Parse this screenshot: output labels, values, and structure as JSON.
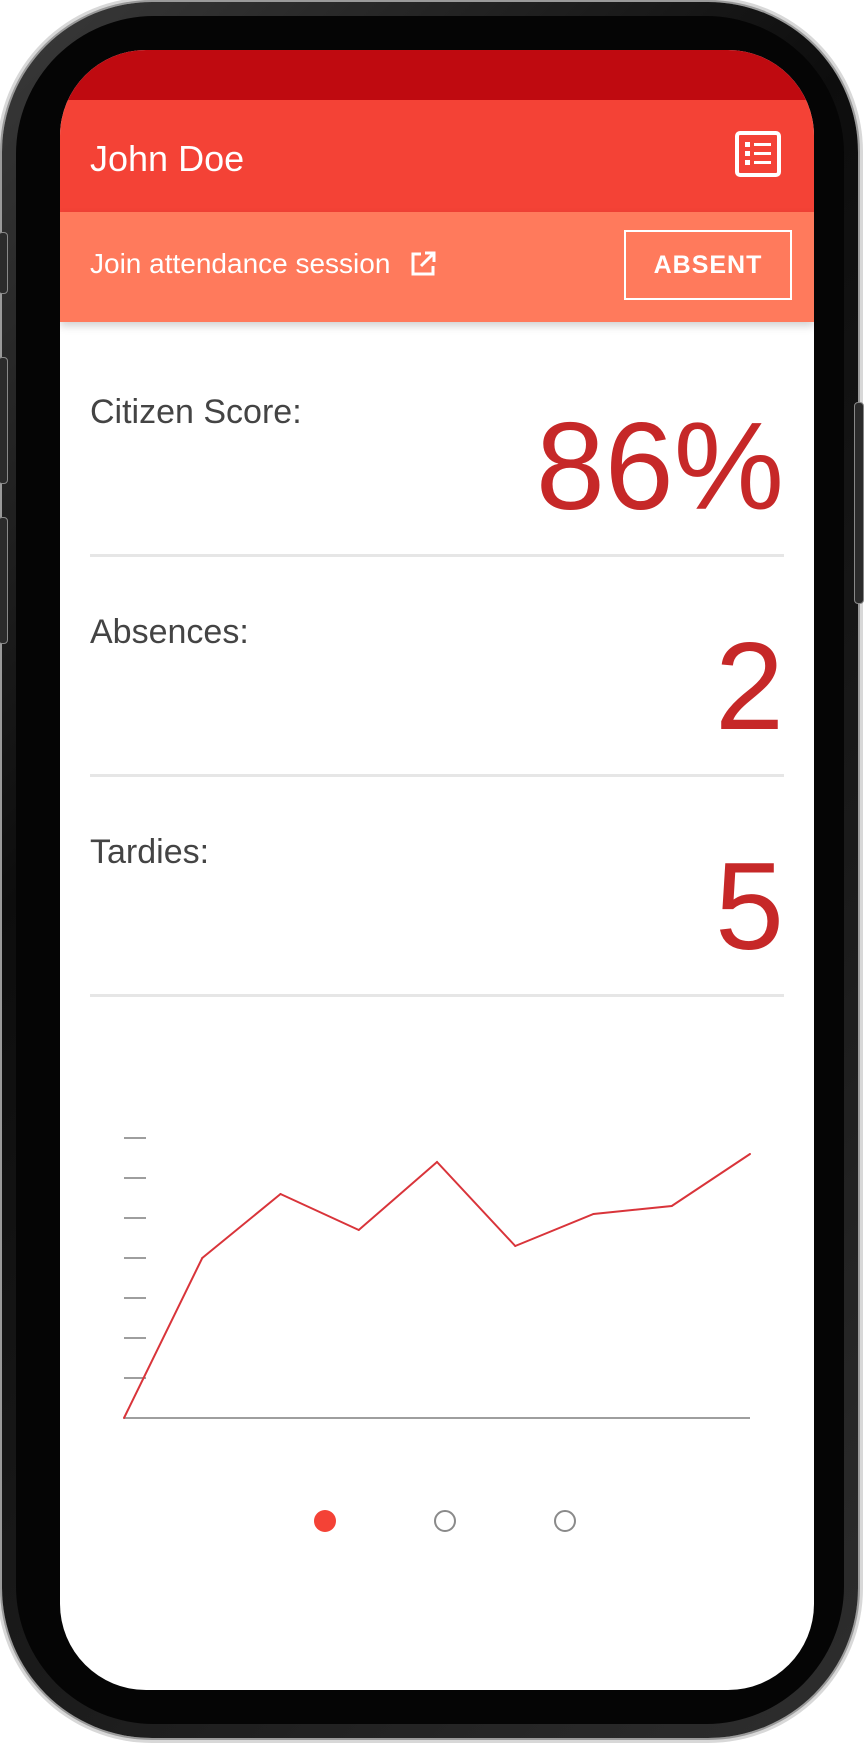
{
  "header": {
    "title": "John Doe",
    "menu_icon": "list-icon"
  },
  "banner": {
    "join_label": "Join attendance session",
    "join_icon": "external-link-icon",
    "status_button": "ABSENT"
  },
  "stats": [
    {
      "label": "Citizen Score:",
      "value": "86%"
    },
    {
      "label": "Absences:",
      "value": "2"
    },
    {
      "label": "Tardies:",
      "value": "5"
    }
  ],
  "chart_data": {
    "type": "line",
    "title": "",
    "xlabel": "",
    "ylabel": "",
    "x": [
      0,
      1,
      2,
      3,
      4,
      5,
      6,
      7,
      8
    ],
    "y_ticks": 7,
    "ylim": [
      0,
      7
    ],
    "series": [
      {
        "values": [
          0,
          4.0,
          5.6,
          4.7,
          6.4,
          4.3,
          5.1,
          5.3,
          6.6
        ]
      }
    ],
    "grid": false,
    "colors": {
      "line": "#d9343a",
      "axis": "#9e9e9e"
    }
  },
  "pagination": {
    "count": 3,
    "active_index": 0
  },
  "colors": {
    "primary": "#f44236",
    "primary_dark": "#bf0a10",
    "banner": "#ff7a5c",
    "value_text": "#c62828"
  }
}
